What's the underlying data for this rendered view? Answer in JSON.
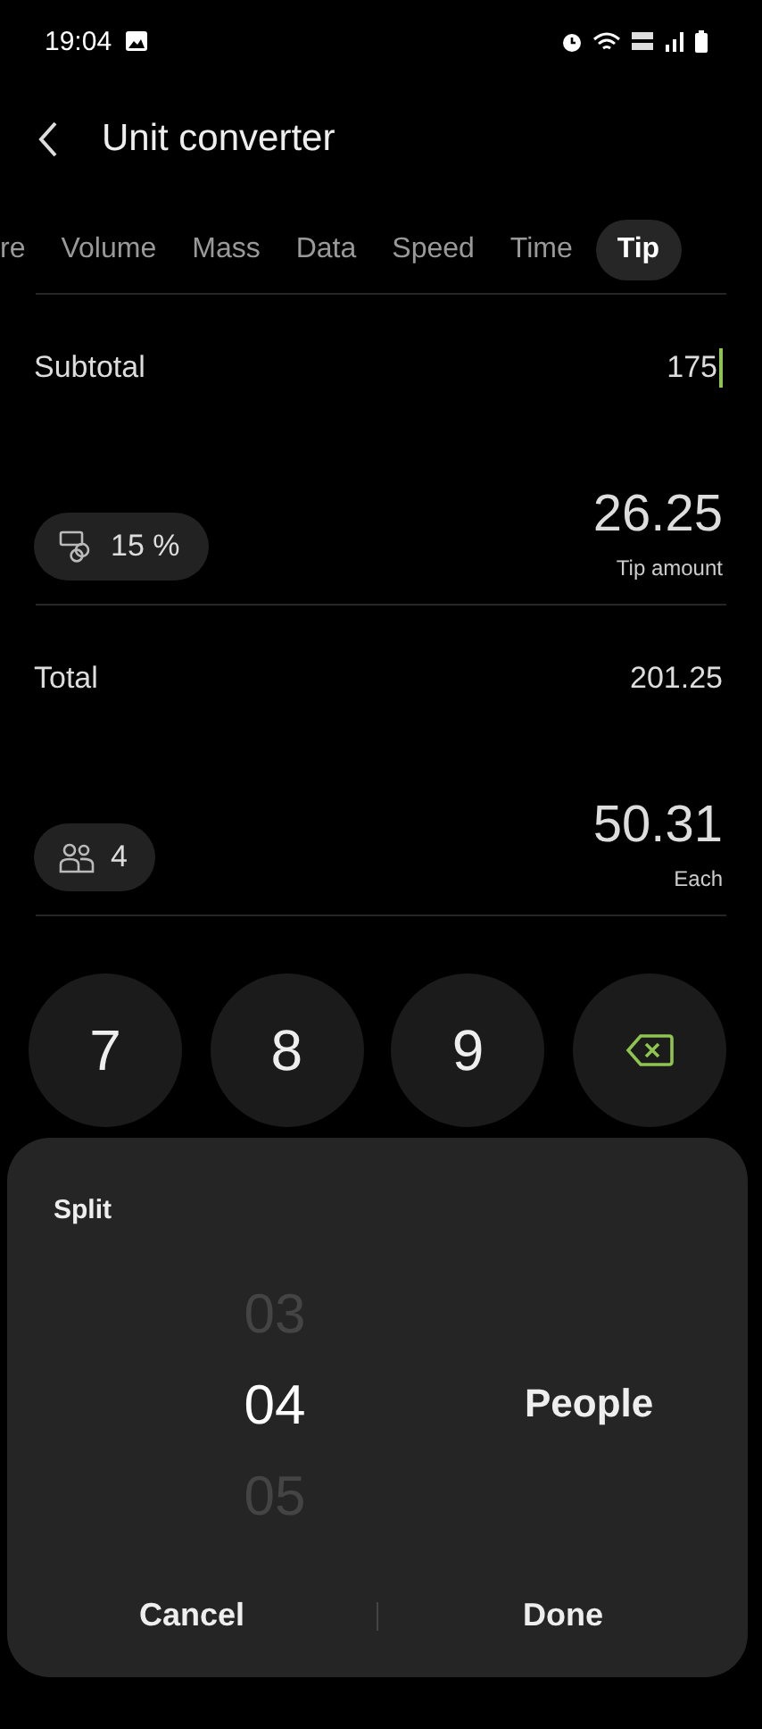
{
  "status_bar": {
    "time": "19:04"
  },
  "header": {
    "title": "Unit converter"
  },
  "tabs": [
    {
      "label": "re",
      "selected": false
    },
    {
      "label": "Volume",
      "selected": false
    },
    {
      "label": "Mass",
      "selected": false
    },
    {
      "label": "Data",
      "selected": false
    },
    {
      "label": "Speed",
      "selected": false
    },
    {
      "label": "Time",
      "selected": false
    },
    {
      "label": "Tip",
      "selected": true
    }
  ],
  "subtotal": {
    "label": "Subtotal",
    "value": "175"
  },
  "tip": {
    "percent": "15 %",
    "amount": "26.25",
    "caption": "Tip amount"
  },
  "total": {
    "label": "Total",
    "value": "201.25"
  },
  "split": {
    "people": "4",
    "amount": "50.31",
    "caption": "Each"
  },
  "keypad": [
    {
      "kind": "digit",
      "label": "7"
    },
    {
      "kind": "digit",
      "label": "8"
    },
    {
      "kind": "digit",
      "label": "9"
    },
    {
      "kind": "backspace"
    }
  ],
  "dialog": {
    "title": "Split",
    "unit": "People",
    "options": [
      {
        "label": "03",
        "selected": false
      },
      {
        "label": "04",
        "selected": true
      },
      {
        "label": "05",
        "selected": false
      }
    ],
    "buttons": [
      "Cancel",
      "Done"
    ]
  }
}
